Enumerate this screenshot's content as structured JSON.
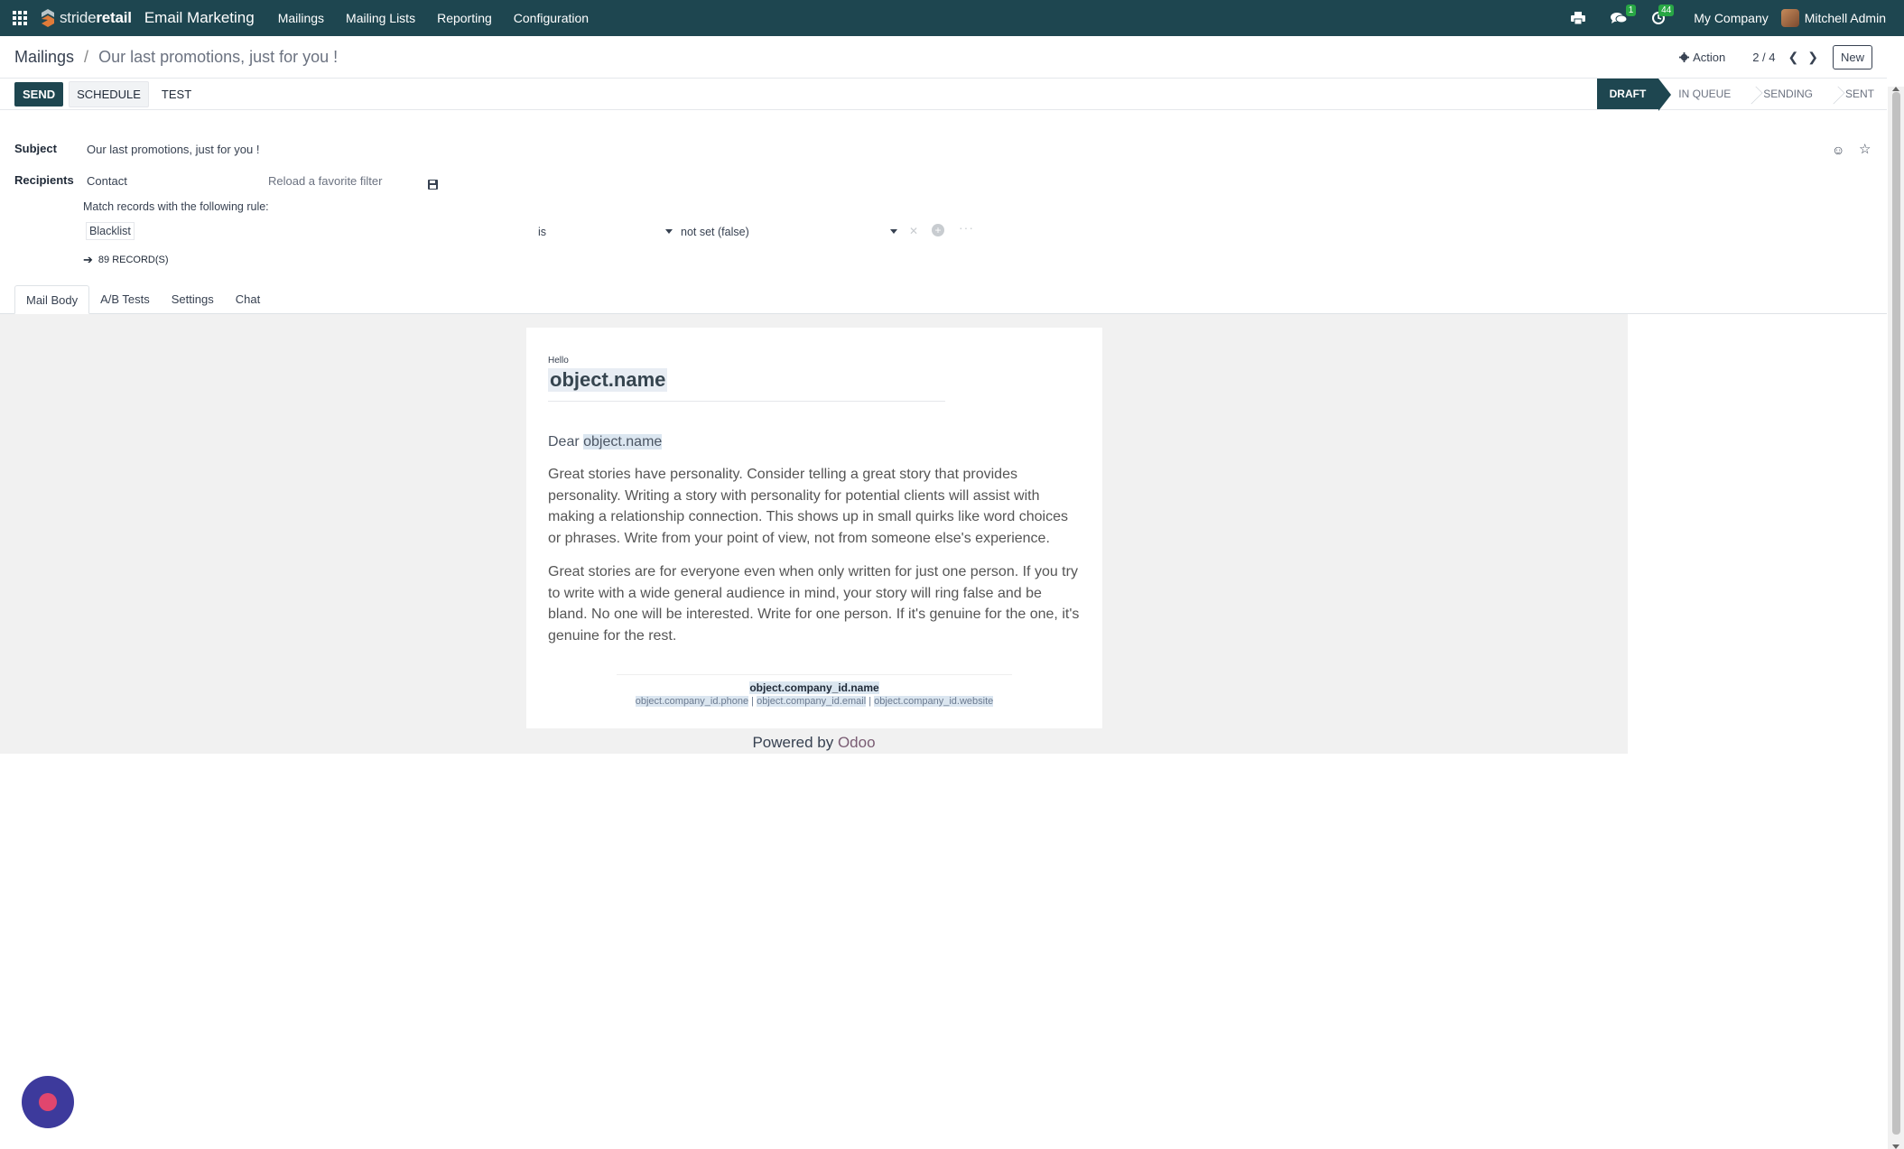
{
  "navbar": {
    "brand_light": "stride",
    "brand_bold": "retail",
    "app_title": "Email Marketing",
    "menu": [
      "Mailings",
      "Mailing Lists",
      "Reporting",
      "Configuration"
    ],
    "messages_badge": "1",
    "activities_badge": "44",
    "company": "My Company",
    "user": "Mitchell Admin",
    "bg_color": "#1e4650"
  },
  "breadcrumb": {
    "root": "Mailings",
    "separator": "/",
    "current": "Our last promotions, just for you !"
  },
  "control": {
    "action_label": "Action",
    "pager": "2 / 4",
    "new_label": "New"
  },
  "statusbar": {
    "send_label": "SEND",
    "schedule_label": "SCHEDULE",
    "test_label": "TEST",
    "stages": [
      "DRAFT",
      "IN QUEUE",
      "SENDING",
      "SENT"
    ],
    "active_stage": "DRAFT"
  },
  "form": {
    "subject_label": "Subject",
    "subject_value": "Our last promotions, just for you !",
    "recipients_label": "Recipients",
    "recipients_value": "Contact",
    "favorite_filter_placeholder": "Reload a favorite filter",
    "rule_text": "Match records with the following rule:",
    "rule_field": "Blacklist",
    "rule_operator": "is",
    "rule_value": "not set (false)",
    "records_count": "89 RECORD(S)"
  },
  "tabs": [
    "Mail Body",
    "A/B Tests",
    "Settings",
    "Chat"
  ],
  "active_tab": "Mail Body",
  "mail": {
    "hello": "Hello",
    "heading": "object.name",
    "dear_prefix": "Dear ",
    "dear_name": "object.name",
    "paragraph1": "Great stories have personality. Consider telling a great story that provides personality. Writing a story with personality for potential clients will assist with making a relationship connection. This shows up in small quirks like word choices or phrases. Write from your point of view, not from someone else's experience.",
    "paragraph2": "Great stories are for everyone even when only written for just one person. If you try to write with a wide general audience in mind, your story will ring false and be bland. No one will be interested. Write for one person. If it's genuine for the one, it's genuine for the rest.",
    "company_name": "object.company_id.name",
    "company_phone": "object.company_id.phone",
    "company_email": "object.company_id.email",
    "company_website": "object.company_id.website",
    "info_sep": " | ",
    "powered_by": "Powered by ",
    "powered_brand": "Odoo"
  }
}
